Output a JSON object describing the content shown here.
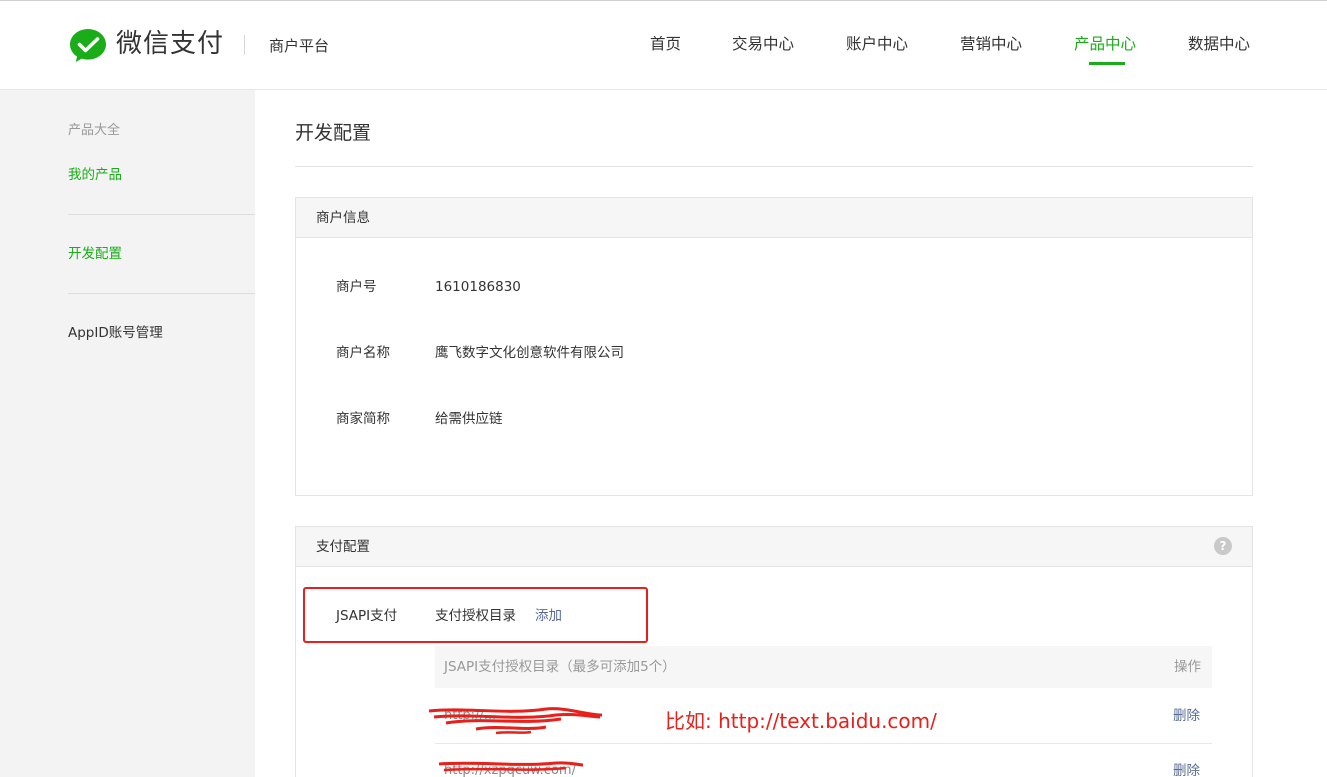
{
  "header": {
    "brand": "微信支付",
    "platform": "商户平台",
    "nav": [
      {
        "label": "首页",
        "active": false
      },
      {
        "label": "交易中心",
        "active": false
      },
      {
        "label": "账户中心",
        "active": false
      },
      {
        "label": "营销中心",
        "active": false
      },
      {
        "label": "产品中心",
        "active": true
      },
      {
        "label": "数据中心",
        "active": false
      }
    ]
  },
  "sidebar": {
    "category": "产品大全",
    "items": [
      {
        "label": "我的产品",
        "active": true
      },
      {
        "label": "开发配置",
        "active": true
      },
      {
        "label": "AppID账号管理",
        "active": false
      }
    ]
  },
  "main": {
    "title": "开发配置",
    "merchant_panel": {
      "title": "商户信息",
      "rows": [
        {
          "label": "商户号",
          "value": "1610186830"
        },
        {
          "label": "商户名称",
          "value": "鹰飞数字文化创意软件有限公司"
        },
        {
          "label": "商家简称",
          "value": "给需供应链"
        }
      ]
    },
    "payment_panel": {
      "title": "支付配置",
      "help_icon": "?",
      "jsapi": {
        "label": "JSAPI支付",
        "field": "支付授权目录",
        "add_link": "添加"
      },
      "table": {
        "column_main": "JSAPI支付授权目录（最多可添加5个）",
        "column_action": "操作",
        "rows": [
          {
            "url": "http://...",
            "action": "删除"
          },
          {
            "url": "http://xzpqcuw.com/",
            "action": "删除"
          }
        ]
      }
    }
  },
  "annotation": {
    "text": "比如: http://text.baidu.com/"
  },
  "colors": {
    "brand_green": "#1aad19",
    "link_blue": "#576b95",
    "annotation_red": "#e8201b"
  }
}
